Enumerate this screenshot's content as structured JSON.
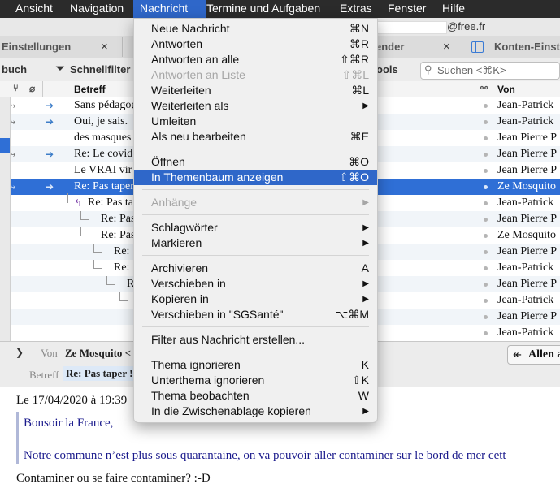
{
  "menubar": {
    "items": [
      {
        "label": "Ansicht"
      },
      {
        "label": "Navigation"
      },
      {
        "label": "Nachricht"
      },
      {
        "label": "Termine und Aufgaben"
      },
      {
        "label": "Extras"
      },
      {
        "label": "Fenster"
      },
      {
        "label": "Hilfe"
      }
    ]
  },
  "tabs": {
    "einstellungen": "Einstellungen",
    "kalender": "ender",
    "konten": "Konten-Einst",
    "close": "×",
    "url_suffix": "@free.fr"
  },
  "toolbar": {
    "adressbuch": "buch",
    "schnellfilter": "Schnellfilter",
    "tools": "ools",
    "search_placeholder": "Suchen <⌘K>"
  },
  "columns": {
    "subject": "Betreff",
    "from": "Von"
  },
  "messages": [
    {
      "subject": "Sans pédagogie",
      "from": "Jean-Patrick"
    },
    {
      "subject": "Oui, je sais.",
      "from": "Jean-Patrick"
    },
    {
      "subject": "des masques",
      "from": "Jean Pierre P"
    },
    {
      "subject": "Re: Le covid",
      "from": "Jean Pierre P"
    },
    {
      "subject": "Le VRAI vir",
      "from": "Jean Pierre P"
    },
    {
      "subject": "Re: Pas taper",
      "from": "Ze Mosquito"
    },
    {
      "subject": "Re: Pas ta",
      "from": "Jean-Patrick"
    },
    {
      "subject": "Re: Pas",
      "from": "Jean Pierre P"
    },
    {
      "subject": "Re: Pas",
      "from": "Ze Mosquito"
    },
    {
      "subject": "Re:",
      "from": "Jean Pierre P"
    },
    {
      "subject": "Re:",
      "from": "Jean-Patrick"
    },
    {
      "subject": "R",
      "from": "Jean Pierre P"
    },
    {
      "subject": "",
      "from": "Jean-Patrick"
    },
    {
      "subject": "",
      "from": "Jean Pierre P"
    },
    {
      "subject": "",
      "from": "Jean-Patrick"
    }
  ],
  "header_pane": {
    "from_label": "Von",
    "from_value": "Ze Mosquito <",
    "subject_label": "Betreff",
    "subject_value": "Re: Pas taper !",
    "reply_all": "Allen a"
  },
  "body": {
    "date_line": "Le 17/04/2020 à 19:39",
    "quote_1": "Bonsoir la France,",
    "quote_2": "Notre commune n’est plus sous quarantaine, on va pouvoir aller contaminer sur le bord de mer cett",
    "reply": "Contaminer ou se faire contaminer? :-D"
  },
  "menu": {
    "items": [
      {
        "label": "Neue Nachricht",
        "shortcut": "⌘N"
      },
      {
        "label": "Antworten",
        "shortcut": "⌘R"
      },
      {
        "label": "Antworten an alle",
        "shortcut": "⇧⌘R"
      },
      {
        "label": "Antworten an Liste",
        "shortcut": "⇧⌘L"
      },
      {
        "label": "Weiterleiten",
        "shortcut": "⌘L"
      },
      {
        "label": "Weiterleiten als",
        "shortcut": "▶"
      },
      {
        "label": "Umleiten",
        "shortcut": ""
      },
      {
        "label": "Als neu bearbeiten",
        "shortcut": "⌘E"
      },
      {
        "label": "Öffnen",
        "shortcut": "⌘O"
      },
      {
        "label": "In Themenbaum anzeigen",
        "shortcut": "⇧⌘O"
      },
      {
        "label": "Anhänge",
        "shortcut": "▶"
      },
      {
        "label": "Schlagwörter",
        "shortcut": "▶"
      },
      {
        "label": "Markieren",
        "shortcut": "▶"
      },
      {
        "label": "Archivieren",
        "shortcut": "A"
      },
      {
        "label": "Verschieben in",
        "shortcut": "▶"
      },
      {
        "label": "Kopieren in",
        "shortcut": "▶"
      },
      {
        "label": "Verschieben in \"SGSanté\"",
        "shortcut": "⌥⌘M"
      },
      {
        "label": "Filter aus Nachricht erstellen...",
        "shortcut": ""
      },
      {
        "label": "Thema ignorieren",
        "shortcut": "K"
      },
      {
        "label": "Unterthema ignorieren",
        "shortcut": "⇧K"
      },
      {
        "label": "Thema beobachten",
        "shortcut": "W"
      },
      {
        "label": "In die Zwischenablage kopieren",
        "shortcut": "▶"
      }
    ]
  },
  "colors": {
    "menubar_bg": "#2b2b2b",
    "menu_highlight": "#2f67c9",
    "row_selected": "#2f6fd6",
    "quote_text": "#1a1a8c"
  }
}
